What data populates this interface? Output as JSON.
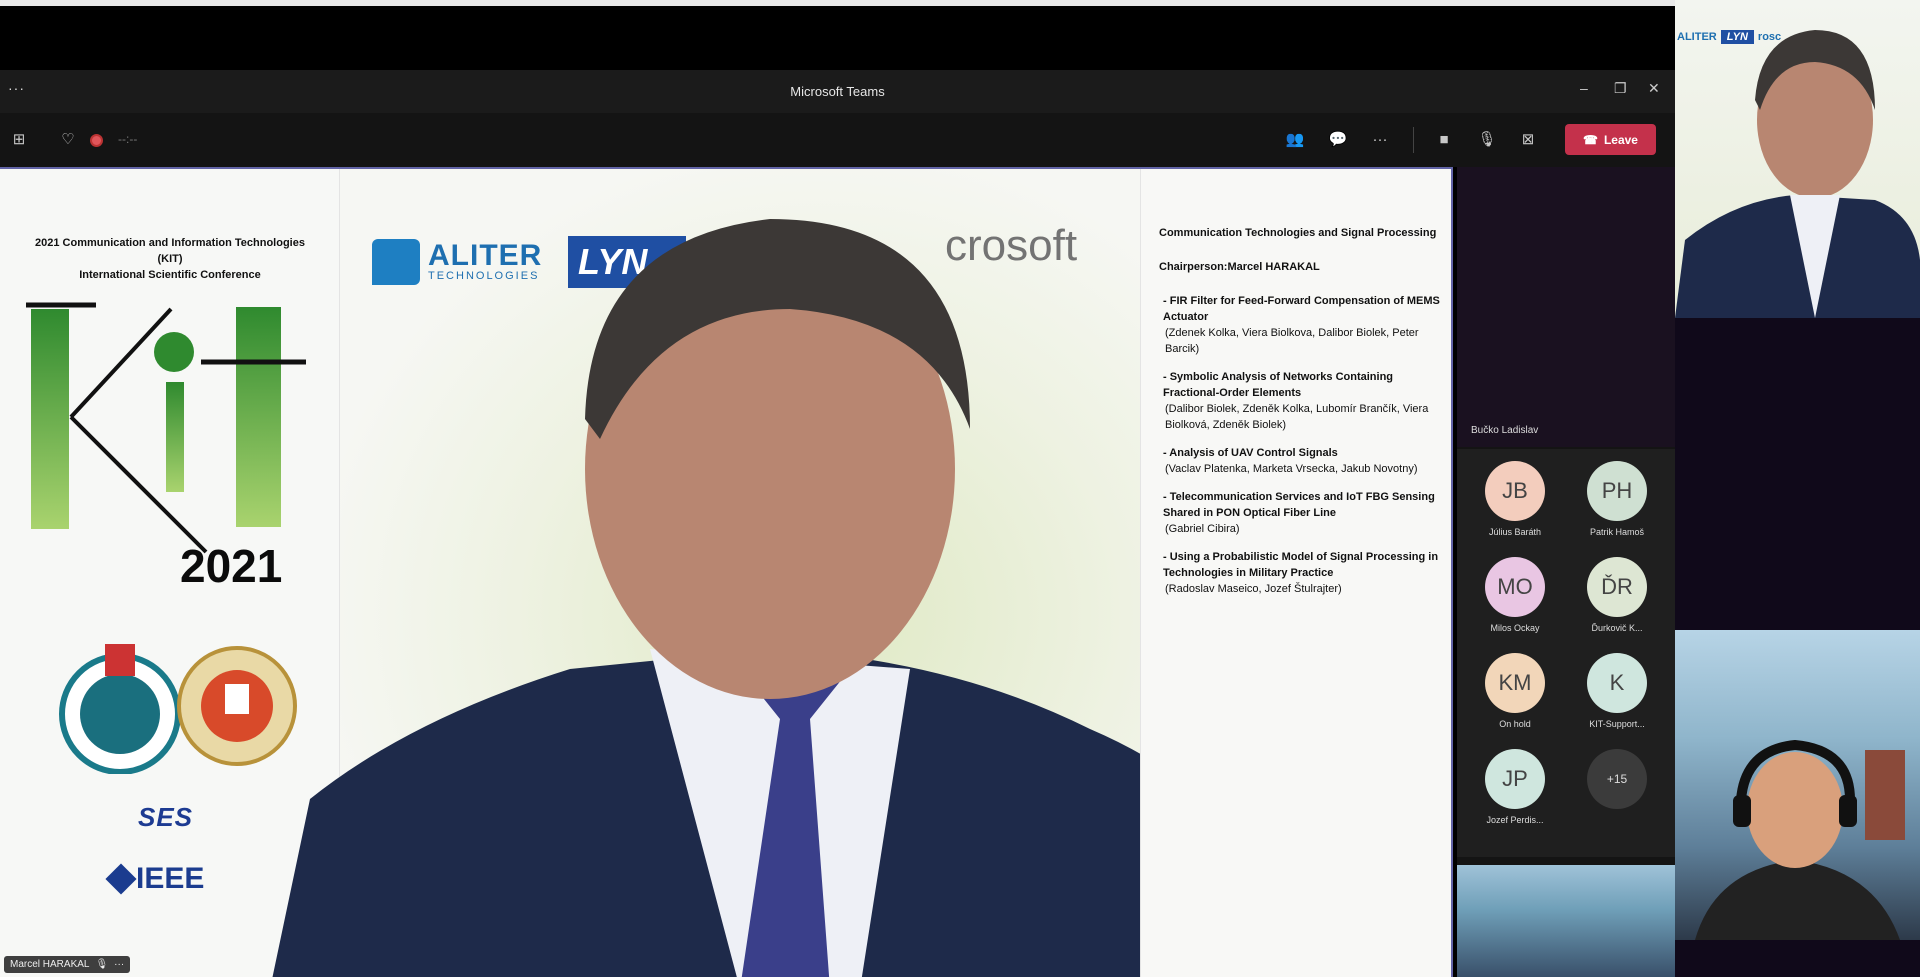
{
  "window": {
    "title": "Microsoft Teams",
    "menu_dots": "···",
    "minimize": "–",
    "restore": "❐",
    "close": "✕"
  },
  "toolbar": {
    "timer": "--:--",
    "leave_label": "Leave"
  },
  "slide": {
    "conference_title_line1": "2021 Communication and Information Technologies (KIT)",
    "conference_title_line2": "International Scientific Conference",
    "year": "2021",
    "ses_logo": "SES",
    "ieee_logo": "IEEE",
    "sponsor_aliter": "ALITER",
    "sponsor_aliter_sub": "TECHNOLOGIES",
    "sponsor_lynx": "LYN",
    "sponsor_microsoft": "crosoft",
    "session_title": "Communication Technologies and Signal Processing",
    "chairperson": "Chairperson:Marcel HARAKAL",
    "papers": [
      {
        "title": "- FIR Filter for Feed-Forward Compensation of MEMS Actuator",
        "authors": "(Zdenek Kolka, Viera Biolkova, Dalibor Biolek, Peter Barcik)"
      },
      {
        "title": "- Symbolic Analysis of Networks Containing Fractional-Order Elements",
        "authors": "(Dalibor Biolek, Zdeněk Kolka, Lubomír Brančík, Viera Biolková, Zdeněk Biolek)"
      },
      {
        "title": "- Analysis of UAV Control Signals",
        "authors": "(Vaclav Platenka, Marketa Vrsecka, Jakub Novotny)"
      },
      {
        "title": "- Telecommunication Services and IoT FBG Sensing Shared in PON Optical Fiber Line",
        "authors": "(Gabriel Cibira)"
      },
      {
        "title": "- Using a Probabilistic Model of Signal Processing in Technologies in Military Practice",
        "authors": "(Radoslav Maseico, Jozef Štulrajter)"
      }
    ]
  },
  "presenter_tag": "Marcel HARAKAL",
  "panel": {
    "top_feed_name": "Bučko Ladislav",
    "participants": [
      {
        "initials": "JB",
        "name": "Július Baráth",
        "color": "#f3cdbd"
      },
      {
        "initials": "PH",
        "name": "Patrik Hamoš",
        "color": "#cfe0d2"
      },
      {
        "initials": "MO",
        "name": "Milos Ockay",
        "color": "#e9c6e3"
      },
      {
        "initials": "ĎR",
        "name": "Ďurkovič K...",
        "color": "#dde6d3"
      },
      {
        "initials": "KM",
        "name": "On hold",
        "color": "#f2d6b9"
      },
      {
        "initials": "K",
        "name": "KIT-Support...",
        "color": "#cfe6de"
      },
      {
        "initials": "JP",
        "name": "Jozef Perdis...",
        "color": "#cfe6de"
      },
      {
        "initials": "+15",
        "name": "",
        "color": "#3b3b3b"
      }
    ]
  },
  "rightcol": {
    "logo_aliter": "ALITER",
    "logo_lynx": "LYN",
    "logo_ms": "rosc"
  }
}
